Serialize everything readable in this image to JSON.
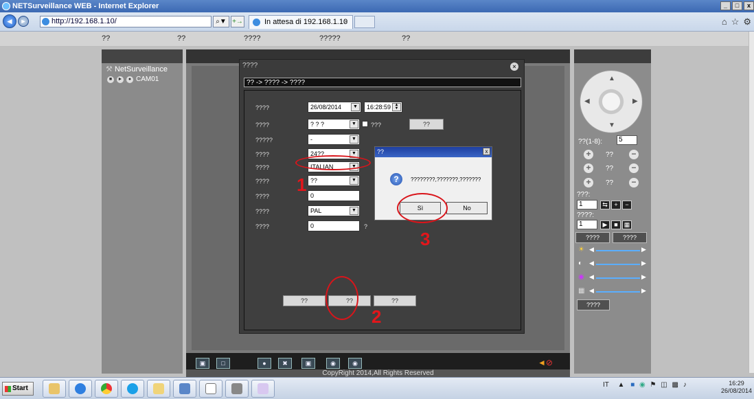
{
  "window": {
    "title": "NETSurveillance WEB - Internet Explorer",
    "buttons": [
      "_",
      "□",
      "x"
    ]
  },
  "address": {
    "back": "◄",
    "forward": "►",
    "url": "http://192.168.1.10/",
    "search_btn": "⌕▼",
    "refresh_btn": "+→",
    "tab_label": "In attesa di 192.168.1.10",
    "tab_close": "×",
    "right_icons": [
      "⌂",
      "☆",
      "⚙"
    ]
  },
  "menubar": {
    "items": [
      "??",
      "??",
      "????",
      "?????",
      "??"
    ]
  },
  "left_panel": {
    "brand": "NetSurveillance",
    "camera": "CAM01"
  },
  "dialog": {
    "title": "????",
    "close": "×",
    "breadcrumb": "?? -> ???? -> ????",
    "fields": [
      {
        "label": "????",
        "value": "26/08/2014",
        "time": "16:28:59",
        "kind": "date"
      },
      {
        "label": "????",
        "value": "? ? ?",
        "checkbox_label": "???",
        "button": "??",
        "kind": "select-check"
      },
      {
        "label": "?????",
        "value": "-",
        "kind": "select"
      },
      {
        "label": "????",
        "value": "24??",
        "kind": "select"
      },
      {
        "label": "????",
        "value": "ITALIAN",
        "kind": "select"
      },
      {
        "label": "????",
        "value": "??",
        "kind": "select"
      },
      {
        "label": "????",
        "value": "0",
        "kind": "text"
      },
      {
        "label": "????",
        "value": "PAL",
        "kind": "select"
      },
      {
        "label": "????",
        "value": "0",
        "suffix": "?",
        "kind": "text"
      }
    ],
    "buttons": [
      "??",
      "??",
      "??"
    ]
  },
  "popup": {
    "title": "??",
    "close": "x",
    "icon": "?",
    "message": "????????,???????,???????",
    "yes": "Sì",
    "no": "No"
  },
  "annotations": [
    "1",
    "2",
    "3"
  ],
  "right_panel": {
    "speed_label": "??(1-8):",
    "speed_value": "5",
    "zoom_label": "??",
    "focus_label": "??",
    "iris_label": "??",
    "preset_label": "???:",
    "preset_value": "1",
    "tour_label": "????:",
    "tour_value": "1",
    "tabs": [
      "????",
      "????"
    ],
    "reset_btn": "????"
  },
  "toolbar": {
    "icons": [
      "fullscreen-icon",
      "window-icon",
      "record-icon",
      "stop-record-icon",
      "snapshot-icon",
      "talk-icon",
      "talk-stop-icon",
      "mute-icon"
    ]
  },
  "copyright": "CopyRight 2014,All Rights Reserved",
  "taskbar": {
    "start": "Start",
    "tray_lang": "IT",
    "clock_time": "16:29",
    "clock_date": "26/08/2014"
  },
  "colors": {
    "annotation": "#d9151b",
    "title_bar": "#3c69b3",
    "dialog_bg": "#3b3b3b"
  }
}
